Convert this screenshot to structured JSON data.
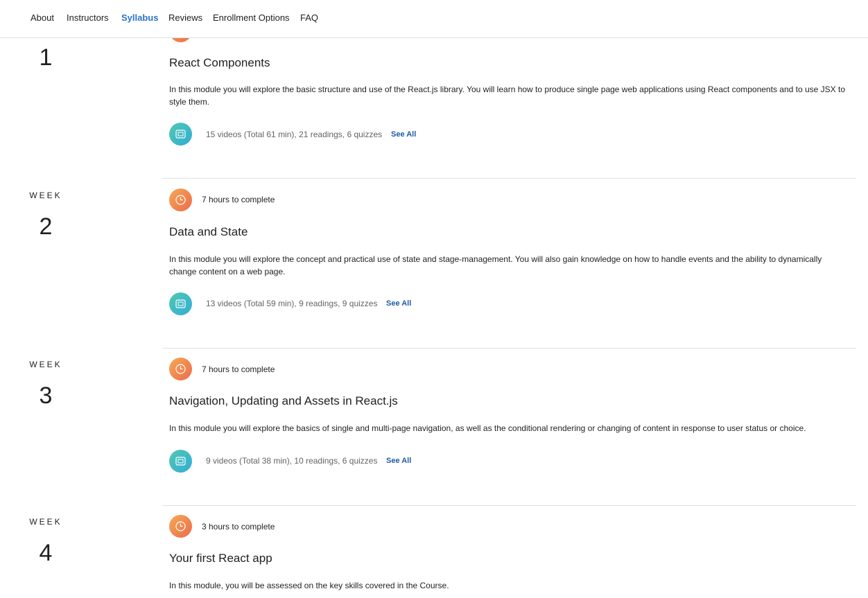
{
  "nav": {
    "items": [
      {
        "label": "About",
        "active": false
      },
      {
        "label": "Instructors",
        "active": false
      },
      {
        "label": "Syllabus",
        "active": true
      },
      {
        "label": "Reviews",
        "active": false
      },
      {
        "label": "Enrollment Options",
        "active": false
      },
      {
        "label": "FAQ",
        "active": false
      }
    ]
  },
  "colors": {
    "accent": "#2a73cc",
    "see_all": "#1f5aa6",
    "clock_gradient": [
      "#f6a85a",
      "#ec6c4e"
    ],
    "content_gradient": [
      "#54c8b0",
      "#36acd3"
    ]
  },
  "weeks": [
    {
      "label": "",
      "number": "1",
      "hours": "",
      "title": "React Components",
      "description": "In this module you will explore the basic structure and use of the React.js library. You will learn how to produce single page web applications using React components and to use JSX to style them.",
      "summary": "15 videos (Total 61 min), 21 readings, 6 quizzes",
      "see_all": "See All"
    },
    {
      "label": "WEEK",
      "number": "2",
      "hours": "7 hours to complete",
      "title": "Data and State",
      "description": "In this module you will explore the concept and practical use of state and stage-management. You will also gain knowledge on how to handle events and the ability to dynamically change content on a web page.",
      "summary": "13 videos (Total 59 min), 9 readings, 9 quizzes",
      "see_all": "See All"
    },
    {
      "label": "WEEK",
      "number": "3",
      "hours": "7 hours to complete",
      "title": "Navigation, Updating and Assets in React.js",
      "description": "In this module you will explore the basics of single and multi-page navigation, as well as the conditional rendering or changing of content in response to user status or choice.",
      "summary": "9 videos (Total 38 min), 10 readings, 6 quizzes",
      "see_all": "See All"
    },
    {
      "label": "WEEK",
      "number": "4",
      "hours": "3 hours to complete",
      "title": "Your first React app",
      "description": "In this module, you will be assessed on the key skills covered in the Course.",
      "summary": "",
      "see_all": ""
    }
  ]
}
